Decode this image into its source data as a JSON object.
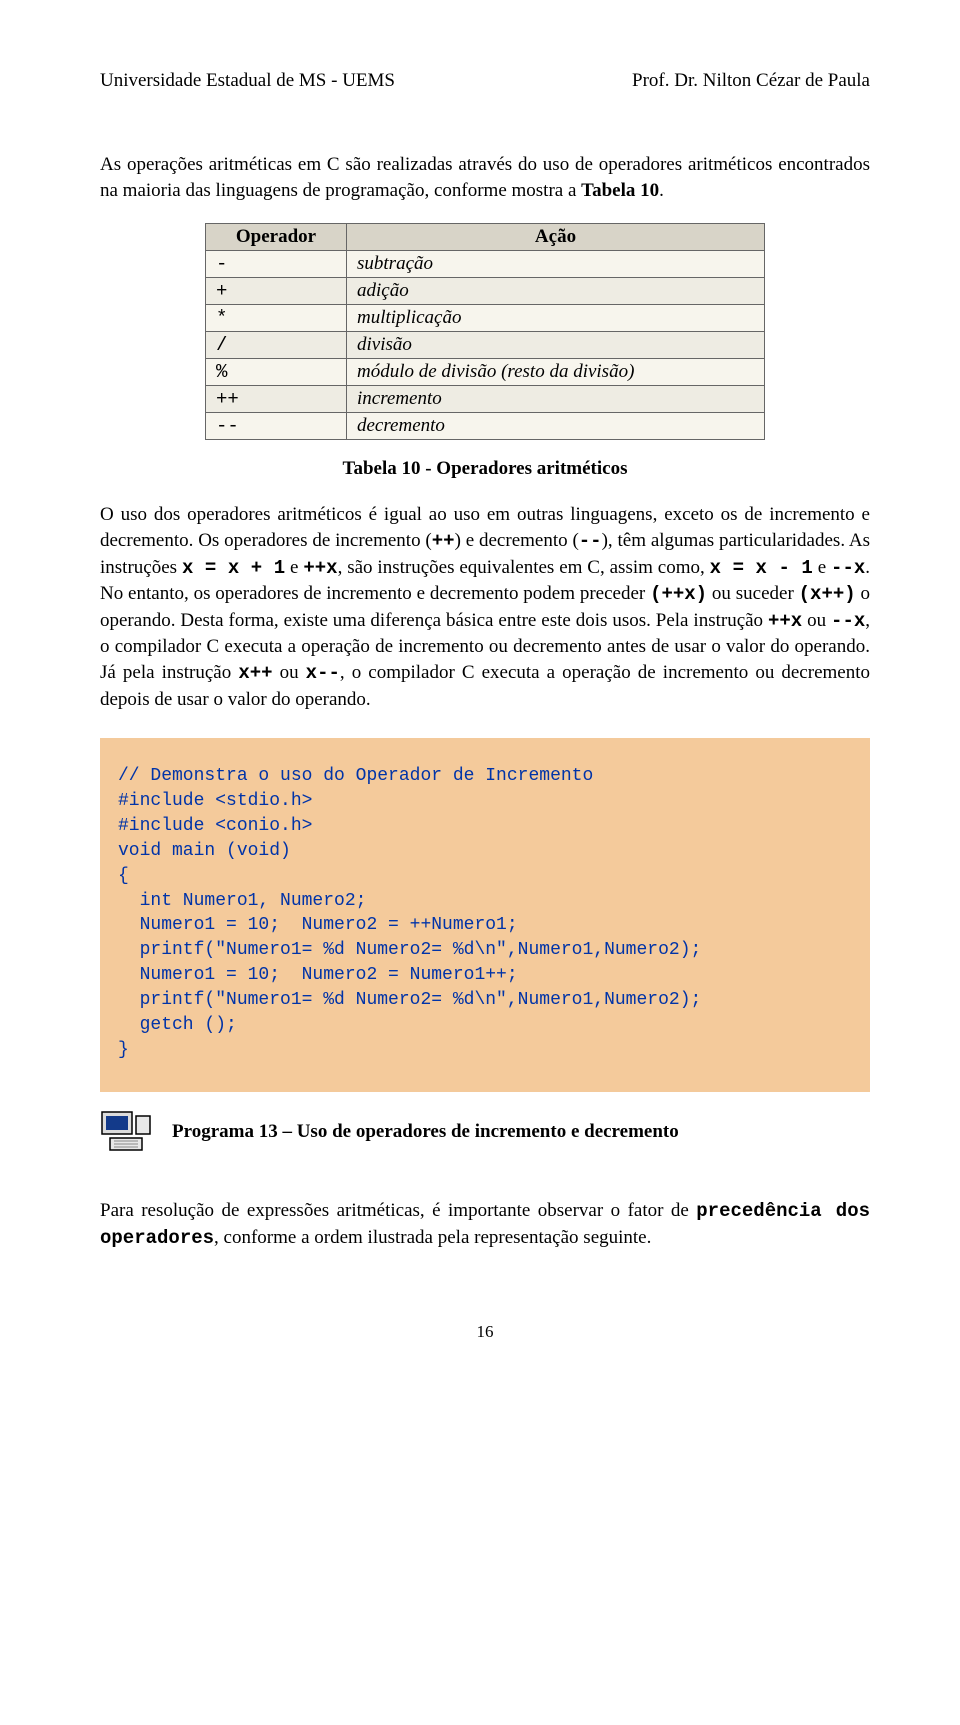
{
  "header": {
    "left": "Universidade Estadual de MS - UEMS",
    "right": "Prof. Dr. Nilton Cézar de Paula"
  },
  "intro": {
    "t1": "As operações aritméticas em C são realizadas através do uso de operadores aritméticos encontrados na maioria das linguagens de programação, conforme mostra a ",
    "t1b": "Tabela 10",
    "t1c": "."
  },
  "table": {
    "head_op": "Operador",
    "head_ac": "Ação",
    "rows": [
      {
        "op": "-",
        "ac": "subtração"
      },
      {
        "op": "+",
        "ac": "adição"
      },
      {
        "op": "*",
        "ac": "multiplicação"
      },
      {
        "op": "/",
        "ac": "divisão"
      },
      {
        "op": "%",
        "ac": "módulo de divisão (resto da divisão)"
      },
      {
        "op": "++",
        "ac": "incremento"
      },
      {
        "op": "--",
        "ac": "decremento"
      }
    ],
    "caption": "Tabela 10 - Operadores aritméticos"
  },
  "body": {
    "p1a": "O uso dos operadores aritméticos é igual ao uso em outras linguagens, exceto os de incremento e decremento. Os operadores de incremento (",
    "p1b": "++",
    "p1c": ") e decremento (",
    "p1d": "--",
    "p1e": "), têm algumas particularidades. As instruções ",
    "p1f": "x = x + 1",
    "p1g": " e ",
    "p1h": "++x",
    "p1i": ", são instruções equivalentes em C, assim como, ",
    "p1j": "x = x - 1",
    "p1k": "  e ",
    "p1l": "--x",
    "p1m": ". No entanto, os operadores de incremento e decremento podem preceder ",
    "p1n": "(++x)",
    "p1o": " ou suceder ",
    "p1p": "(x++)",
    "p1q": " o operando. Desta forma, existe uma diferença básica entre este dois usos. Pela instrução ",
    "p1r": "++x",
    "p1s": "  ou ",
    "p1t": "--x",
    "p1u": ", o compilador C executa a operação de incremento ou decremento antes de usar o valor do operando. Já pela instrução ",
    "p1v": "x++",
    "p1w": "  ou ",
    "p1x": "x--",
    "p1y": ", o compilador C executa a operação de incremento ou decremento depois de usar o valor do operando."
  },
  "code": "// Demonstra o uso do Operador de Incremento\n#include <stdio.h>\n#include <conio.h>\nvoid main (void)\n{\n  int Numero1, Numero2;\n  Numero1 = 10;  Numero2 = ++Numero1;\n  printf(\"Numero1= %d Numero2= %d\\n\",Numero1,Numero2);\n  Numero1 = 10;  Numero2 = Numero1++;\n  printf(\"Numero1= %d Numero2= %d\\n\",Numero1,Numero2);\n  getch ();\n}",
  "program_caption": "Programa 13 – Uso de operadores de incremento e decremento",
  "closing": {
    "t1": "Para resolução de expressões aritméticas, é importante observar o fator de ",
    "t2": "precedência dos operadores",
    "t3": ", conforme a ordem ilustrada pela representação seguinte."
  },
  "page_number": "16"
}
